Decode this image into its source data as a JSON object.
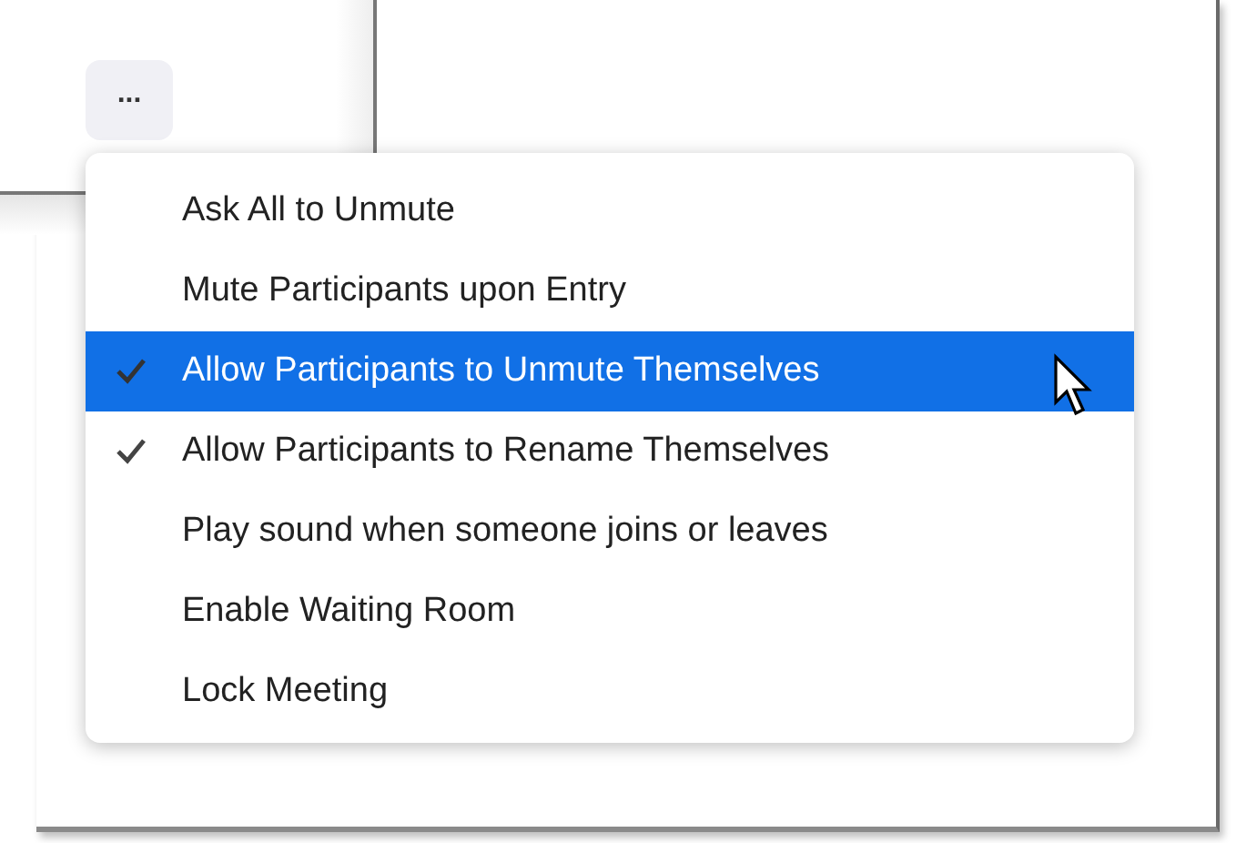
{
  "more_button": {
    "label": "..."
  },
  "menu": {
    "items": [
      {
        "label": "Ask All to Unmute",
        "checked": false,
        "highlighted": false
      },
      {
        "label": "Mute Participants upon Entry",
        "checked": false,
        "highlighted": false
      },
      {
        "label": "Allow Participants to Unmute Themselves",
        "checked": true,
        "highlighted": true
      },
      {
        "label": "Allow Participants to Rename Themselves",
        "checked": true,
        "highlighted": false
      },
      {
        "label": "Play sound when someone joins or leaves",
        "checked": false,
        "highlighted": false
      },
      {
        "label": "Enable Waiting Room",
        "checked": false,
        "highlighted": false
      },
      {
        "label": "Lock Meeting",
        "checked": false,
        "highlighted": false
      }
    ]
  }
}
